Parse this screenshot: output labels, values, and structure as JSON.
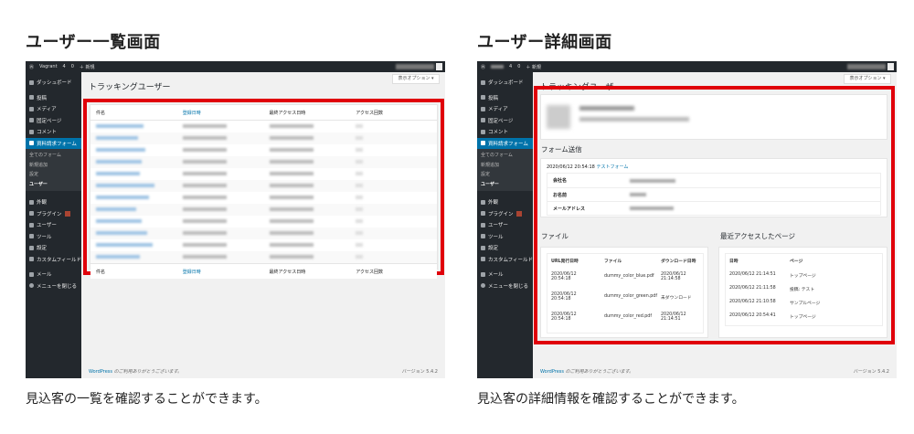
{
  "left": {
    "heading": "ユーザー一覧画面",
    "caption": "見込客の一覧を確認することができます。",
    "page_title": "トラッキングユーザー",
    "options_label": "表示オプション ▾",
    "columns": [
      "件名",
      "登録日時",
      "最終アクセス日時",
      "アクセス回数"
    ],
    "row_count": 12
  },
  "right": {
    "heading": "ユーザー詳細画面",
    "caption": "見込客の詳細情報を確認することができます。",
    "page_title": "トラッキングユーザー",
    "options_label": "表示オプション ▾",
    "form_section": "フォーム送信",
    "form_timestamp": "2020/06/12 20:54:18",
    "form_link": "テストフォーム",
    "form_fields": [
      "会社名",
      "お名前",
      "メールアドレス"
    ],
    "files_section": "ファイル",
    "files_columns": [
      "URL発行日時",
      "ファイル",
      "ダウンロード日時"
    ],
    "files_rows": [
      [
        "2020/06/12 20:54:18",
        "dummy_color_blue.pdf",
        "2020/06/12 21:14:58"
      ],
      [
        "2020/06/12 20:54:18",
        "dummy_color_green.pdf",
        "未ダウンロード"
      ],
      [
        "2020/06/12 20:54:18",
        "dummy_color_red.pdf",
        "2020/06/12 21:14:51"
      ]
    ],
    "recent_section": "最近アクセスしたページ",
    "recent_columns": [
      "日時",
      "ページ"
    ],
    "recent_rows": [
      [
        "2020/06/12 21:14:51",
        "トップページ"
      ],
      [
        "2020/06/12 21:11:58",
        "投稿: テスト"
      ],
      [
        "2020/06/12 21:10:58",
        "サンプルページ"
      ],
      [
        "2020/06/12 20:54:41",
        "トップページ"
      ]
    ]
  },
  "admin": {
    "site_name": "Vagrant",
    "new_label": "＋ 新規",
    "comments_count": "0",
    "updates_count": "4",
    "footer_link": "WordPress",
    "footer_text": " のご利用ありがとうございます。",
    "version": "バージョン 5.4.2",
    "menu": [
      "ダッシュボード",
      "投稿",
      "メディア",
      "固定ページ",
      "コメント",
      "資料請求フォーム"
    ],
    "submenu": [
      "全てのフォーム",
      "新規追加",
      "設定",
      "ユーザー"
    ],
    "menu2": [
      "外観",
      "プラグイン",
      "ユーザー",
      "ツール",
      "設定",
      "カスタムフィールド",
      "メール",
      "メニューを閉じる"
    ]
  },
  "colors": {
    "accent": "#0073aa",
    "highlight": "#e0000a",
    "sidebar": "#23282d"
  }
}
